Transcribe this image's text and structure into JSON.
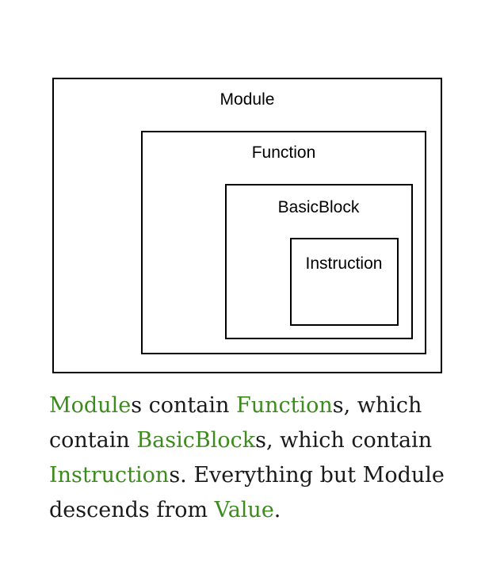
{
  "diagram": {
    "module_label": "Module",
    "function_label": "Function",
    "basicblock_label": "BasicBlock",
    "instruction_label": "Instruction"
  },
  "caption": {
    "highlight_color": "#3d8a1e",
    "segments": [
      {
        "text": "Module",
        "highlight": true
      },
      {
        "text": "s contain ",
        "highlight": false
      },
      {
        "text": "Function",
        "highlight": true
      },
      {
        "text": "s, which contain ",
        "highlight": false
      },
      {
        "text": "BasicBlock",
        "highlight": true
      },
      {
        "text": "s, which contain ",
        "highlight": false
      },
      {
        "text": "Instruction",
        "highlight": true
      },
      {
        "text": "s. Everything but Module descends from ",
        "highlight": false
      },
      {
        "text": "Value",
        "highlight": true
      },
      {
        "text": ".",
        "highlight": false
      }
    ]
  }
}
